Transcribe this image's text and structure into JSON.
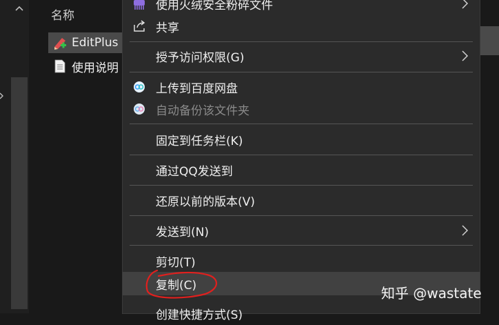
{
  "explorer": {
    "column_header": "名称",
    "files": [
      {
        "name": "EditPlus",
        "icon": "editplus-icon"
      },
      {
        "name": "使用说明",
        "icon": "text-file-icon"
      }
    ]
  },
  "menu": {
    "items": {
      "shred": "使用火绒安全粉碎文件",
      "share": "共享",
      "grant_access": "授予访问权限(G)",
      "upload_baidu": "上传到百度网盘",
      "auto_backup": "自动备份该文件夹",
      "pin_taskbar": "固定到任务栏(K)",
      "send_qq": "通过QQ发送到",
      "restore": "还原以前的版本(V)",
      "send_to": "发送到(N)",
      "cut": "剪切(T)",
      "copy": "复制(C)",
      "create_shortcut": "创建快捷方式(S)"
    }
  },
  "watermark": "知乎 @wastate",
  "colors": {
    "menu_bg": "#2b2b2b",
    "hover_bg": "#414141",
    "annotation_red": "#e0201e"
  }
}
